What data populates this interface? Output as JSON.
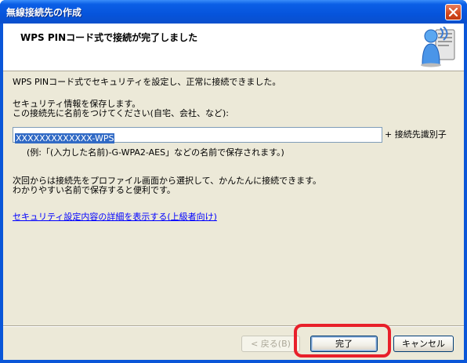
{
  "window": {
    "title": "無線接続先の作成"
  },
  "header": {
    "title": "WPS PINコード式で接続が完了しました"
  },
  "body": {
    "line1": "WPS PINコード式でセキュリティを設定し、正常に接続できました。",
    "line2": "セキュリティ情報を保存します。",
    "line3": "この接続先に名前をつけてください(自宅、会社、など):",
    "ssid_value": "XXXXXXXXXXXXX-WPS",
    "suffix_label": "+ 接続先識別子",
    "example": "(例:「(入力した名前)-G-WPA2-AES」などの名前で保存されます。)",
    "info1": "次回からは接続先をプロファイル画面から選択して、かんたんに接続できます。",
    "info2": "わかりやすい名前で保存すると便利です。",
    "details_link": "セキュリティ設定内容の詳細を表示する(上級者向け)"
  },
  "buttons": {
    "back": "< 戻る(B)",
    "finish": "完了",
    "cancel": "キャンセル"
  },
  "colors": {
    "titlebar": "#0654dc",
    "highlight": "#e8202a",
    "selection": "#316ac5"
  },
  "icons": {
    "close": "close-icon",
    "header": "wireless-user-icon"
  }
}
